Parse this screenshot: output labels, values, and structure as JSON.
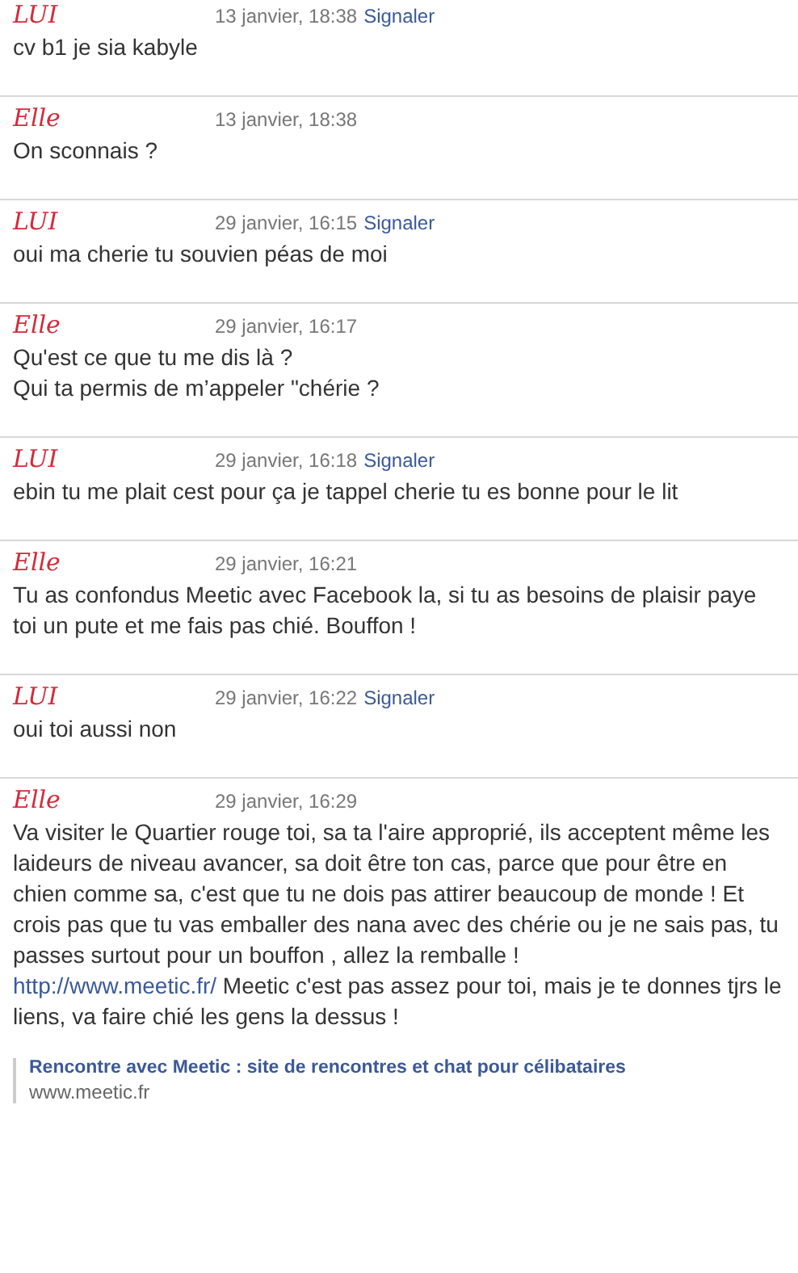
{
  "messages": [
    {
      "author": "LUI",
      "time": "13 janvier, 18:38",
      "report": "Signaler",
      "lines": [
        "cv b1 je sia kabyle"
      ]
    },
    {
      "author": "Elle",
      "time": "13 janvier, 18:38",
      "lines": [
        "On sconnais ?"
      ]
    },
    {
      "author": "LUI",
      "time": "29 janvier, 16:15",
      "report": "Signaler",
      "lines": [
        "oui ma cherie tu souvien péas de moi"
      ]
    },
    {
      "author": "Elle",
      "time": "29 janvier, 16:17",
      "lines": [
        "Qu'est ce que tu me dis là ?",
        "Qui ta permis de m’appeler \"chérie ?"
      ]
    },
    {
      "author": "LUI",
      "time": "29 janvier, 16:18",
      "report": "Signaler",
      "lines": [
        "ebin tu me plait cest pour ça je tappel cherie tu es bonne pour le lit"
      ]
    },
    {
      "author": "Elle",
      "time": "29 janvier, 16:21",
      "lines": [
        "Tu as confondus Meetic avec Facebook la, si tu as besoins de plaisir paye toi un pute et me fais pas chié. Bouffon !"
      ]
    },
    {
      "author": "LUI",
      "time": "29 janvier, 16:22",
      "report": "Signaler",
      "lines": [
        "oui toi aussi non"
      ]
    },
    {
      "author": "Elle",
      "time": "29 janvier, 16:29",
      "lines": [
        "Va visiter le Quartier rouge toi, sa ta l'aire approprié, ils acceptent même les laideurs de niveau avancer, sa doit être ton cas, parce que pour être en chien comme sa, c'est que tu ne dois pas attirer beaucoup de monde ! Et crois pas que tu vas emballer des nana avec des chérie ou je ne sais pas, tu passes surtout pour un bouffon , allez la remballe !"
      ],
      "link": {
        "url": "http://www.meetic.fr/",
        "after": "Meetic c'est pas assez pour toi, mais je te donnes tjrs le liens, va faire chié les gens la dessus !"
      },
      "attachment": {
        "title": "Rencontre avec Meetic : site de rencontres et chat pour célibataires",
        "domain": "www.meetic.fr"
      }
    }
  ]
}
